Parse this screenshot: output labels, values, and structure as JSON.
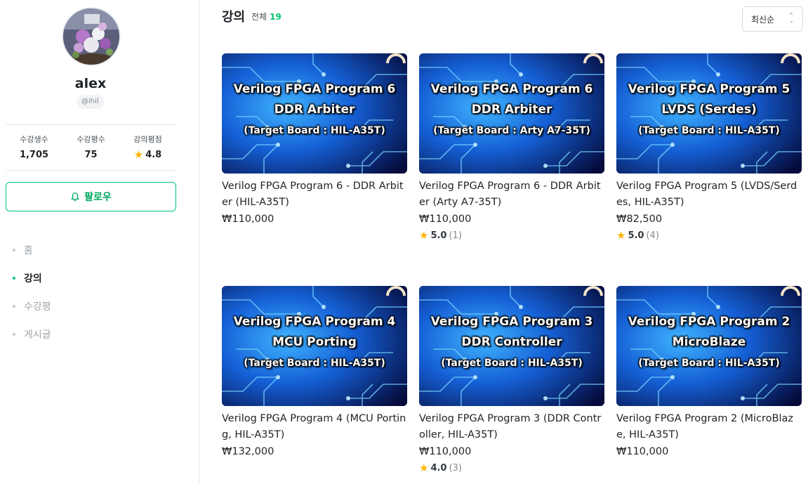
{
  "profile": {
    "name": "alex",
    "handle": "@ihil",
    "stats": [
      {
        "label": "수강생수",
        "value": "1,705"
      },
      {
        "label": "수강평수",
        "value": "75"
      },
      {
        "label": "강의평점",
        "value": "4.8"
      }
    ],
    "follow_label": "팔로우"
  },
  "nav": {
    "items": [
      {
        "label": "홈"
      },
      {
        "label": "강의"
      },
      {
        "label": "수강평"
      },
      {
        "label": "게시글"
      }
    ],
    "active": "강의"
  },
  "main": {
    "title": "강의",
    "total_label": "전체",
    "total_count": "19",
    "sort_label": "최신순"
  },
  "courses": [
    {
      "thumb_line1": "Verilog FPGA Program 6",
      "thumb_line2": "DDR Arbiter",
      "thumb_line3": "(Target Board : HIL-A35T)",
      "title": "Verilog FPGA Program 6 - DDR Arbiter (HIL-A35T)",
      "price": "₩110,000",
      "rating": "",
      "rating_count": ""
    },
    {
      "thumb_line1": "Verilog FPGA Program 6",
      "thumb_line2": "DDR Arbiter",
      "thumb_line3": "(Target Board : Arty A7-35T)",
      "title": "Verilog FPGA Program 6 - DDR Arbiter (Arty A7-35T)",
      "price": "₩110,000",
      "rating": "5.0",
      "rating_count": "(1)"
    },
    {
      "thumb_line1": "Verilog FPGA Program 5",
      "thumb_line2": "LVDS (Serdes)",
      "thumb_line3": "(Target Board : HIL-A35T)",
      "title": "Verilog FPGA Program 5 (LVDS/Serdes, HIL-A35T)",
      "price": "₩82,500",
      "rating": "5.0",
      "rating_count": "(4)"
    },
    {
      "thumb_line1": "Verilog FPGA Program 4",
      "thumb_line2": "MCU Porting",
      "thumb_line3": "(Target Board : HIL-A35T)",
      "title": "Verilog FPGA Program 4 (MCU Porting, HIL-A35T)",
      "price": "₩132,000",
      "rating": "",
      "rating_count": ""
    },
    {
      "thumb_line1": "Verilog FPGA Program 3",
      "thumb_line2": "DDR Controller",
      "thumb_line3": "(Target Board : HIL-A35T)",
      "title": "Verilog FPGA Program 3 (DDR Controller, HIL-A35T)",
      "price": "₩110,000",
      "rating": "4.0",
      "rating_count": "(3)"
    },
    {
      "thumb_line1": "Verilog FPGA Program 2",
      "thumb_line2": "MicroBlaze",
      "thumb_line3": "(Target Board : HIL-A35T)",
      "title": "Verilog FPGA Program 2 (MicroBlaze, HIL-A35T)",
      "price": "₩110,000",
      "rating": "",
      "rating_count": ""
    }
  ],
  "colors": {
    "accent": "#00c471",
    "star": "#fdb300",
    "thumb_bg": "#0a1f6b"
  },
  "icons": [
    "bell-icon",
    "star-icon",
    "chevron-updown-icon"
  ]
}
